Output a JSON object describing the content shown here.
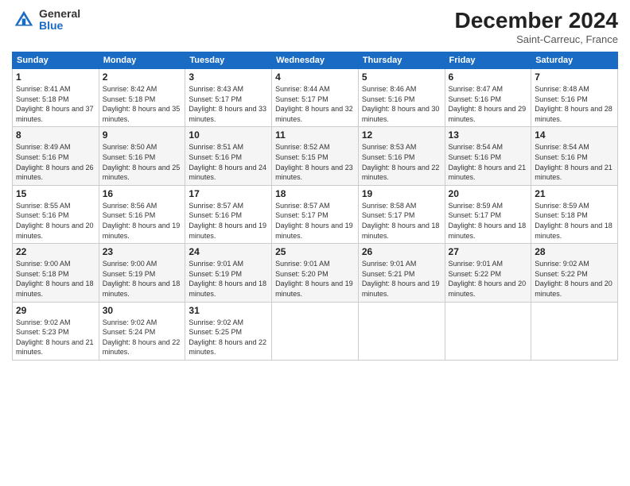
{
  "logo": {
    "general": "General",
    "blue": "Blue"
  },
  "title": "December 2024",
  "location": "Saint-Carreuc, France",
  "days_of_week": [
    "Sunday",
    "Monday",
    "Tuesday",
    "Wednesday",
    "Thursday",
    "Friday",
    "Saturday"
  ],
  "weeks": [
    [
      {
        "day": "1",
        "sunrise": "Sunrise: 8:41 AM",
        "sunset": "Sunset: 5:18 PM",
        "daylight": "Daylight: 8 hours and 37 minutes."
      },
      {
        "day": "2",
        "sunrise": "Sunrise: 8:42 AM",
        "sunset": "Sunset: 5:18 PM",
        "daylight": "Daylight: 8 hours and 35 minutes."
      },
      {
        "day": "3",
        "sunrise": "Sunrise: 8:43 AM",
        "sunset": "Sunset: 5:17 PM",
        "daylight": "Daylight: 8 hours and 33 minutes."
      },
      {
        "day": "4",
        "sunrise": "Sunrise: 8:44 AM",
        "sunset": "Sunset: 5:17 PM",
        "daylight": "Daylight: 8 hours and 32 minutes."
      },
      {
        "day": "5",
        "sunrise": "Sunrise: 8:46 AM",
        "sunset": "Sunset: 5:16 PM",
        "daylight": "Daylight: 8 hours and 30 minutes."
      },
      {
        "day": "6",
        "sunrise": "Sunrise: 8:47 AM",
        "sunset": "Sunset: 5:16 PM",
        "daylight": "Daylight: 8 hours and 29 minutes."
      },
      {
        "day": "7",
        "sunrise": "Sunrise: 8:48 AM",
        "sunset": "Sunset: 5:16 PM",
        "daylight": "Daylight: 8 hours and 28 minutes."
      }
    ],
    [
      {
        "day": "8",
        "sunrise": "Sunrise: 8:49 AM",
        "sunset": "Sunset: 5:16 PM",
        "daylight": "Daylight: 8 hours and 26 minutes."
      },
      {
        "day": "9",
        "sunrise": "Sunrise: 8:50 AM",
        "sunset": "Sunset: 5:16 PM",
        "daylight": "Daylight: 8 hours and 25 minutes."
      },
      {
        "day": "10",
        "sunrise": "Sunrise: 8:51 AM",
        "sunset": "Sunset: 5:16 PM",
        "daylight": "Daylight: 8 hours and 24 minutes."
      },
      {
        "day": "11",
        "sunrise": "Sunrise: 8:52 AM",
        "sunset": "Sunset: 5:15 PM",
        "daylight": "Daylight: 8 hours and 23 minutes."
      },
      {
        "day": "12",
        "sunrise": "Sunrise: 8:53 AM",
        "sunset": "Sunset: 5:16 PM",
        "daylight": "Daylight: 8 hours and 22 minutes."
      },
      {
        "day": "13",
        "sunrise": "Sunrise: 8:54 AM",
        "sunset": "Sunset: 5:16 PM",
        "daylight": "Daylight: 8 hours and 21 minutes."
      },
      {
        "day": "14",
        "sunrise": "Sunrise: 8:54 AM",
        "sunset": "Sunset: 5:16 PM",
        "daylight": "Daylight: 8 hours and 21 minutes."
      }
    ],
    [
      {
        "day": "15",
        "sunrise": "Sunrise: 8:55 AM",
        "sunset": "Sunset: 5:16 PM",
        "daylight": "Daylight: 8 hours and 20 minutes."
      },
      {
        "day": "16",
        "sunrise": "Sunrise: 8:56 AM",
        "sunset": "Sunset: 5:16 PM",
        "daylight": "Daylight: 8 hours and 19 minutes."
      },
      {
        "day": "17",
        "sunrise": "Sunrise: 8:57 AM",
        "sunset": "Sunset: 5:16 PM",
        "daylight": "Daylight: 8 hours and 19 minutes."
      },
      {
        "day": "18",
        "sunrise": "Sunrise: 8:57 AM",
        "sunset": "Sunset: 5:17 PM",
        "daylight": "Daylight: 8 hours and 19 minutes."
      },
      {
        "day": "19",
        "sunrise": "Sunrise: 8:58 AM",
        "sunset": "Sunset: 5:17 PM",
        "daylight": "Daylight: 8 hours and 18 minutes."
      },
      {
        "day": "20",
        "sunrise": "Sunrise: 8:59 AM",
        "sunset": "Sunset: 5:17 PM",
        "daylight": "Daylight: 8 hours and 18 minutes."
      },
      {
        "day": "21",
        "sunrise": "Sunrise: 8:59 AM",
        "sunset": "Sunset: 5:18 PM",
        "daylight": "Daylight: 8 hours and 18 minutes."
      }
    ],
    [
      {
        "day": "22",
        "sunrise": "Sunrise: 9:00 AM",
        "sunset": "Sunset: 5:18 PM",
        "daylight": "Daylight: 8 hours and 18 minutes."
      },
      {
        "day": "23",
        "sunrise": "Sunrise: 9:00 AM",
        "sunset": "Sunset: 5:19 PM",
        "daylight": "Daylight: 8 hours and 18 minutes."
      },
      {
        "day": "24",
        "sunrise": "Sunrise: 9:01 AM",
        "sunset": "Sunset: 5:19 PM",
        "daylight": "Daylight: 8 hours and 18 minutes."
      },
      {
        "day": "25",
        "sunrise": "Sunrise: 9:01 AM",
        "sunset": "Sunset: 5:20 PM",
        "daylight": "Daylight: 8 hours and 19 minutes."
      },
      {
        "day": "26",
        "sunrise": "Sunrise: 9:01 AM",
        "sunset": "Sunset: 5:21 PM",
        "daylight": "Daylight: 8 hours and 19 minutes."
      },
      {
        "day": "27",
        "sunrise": "Sunrise: 9:01 AM",
        "sunset": "Sunset: 5:22 PM",
        "daylight": "Daylight: 8 hours and 20 minutes."
      },
      {
        "day": "28",
        "sunrise": "Sunrise: 9:02 AM",
        "sunset": "Sunset: 5:22 PM",
        "daylight": "Daylight: 8 hours and 20 minutes."
      }
    ],
    [
      {
        "day": "29",
        "sunrise": "Sunrise: 9:02 AM",
        "sunset": "Sunset: 5:23 PM",
        "daylight": "Daylight: 8 hours and 21 minutes."
      },
      {
        "day": "30",
        "sunrise": "Sunrise: 9:02 AM",
        "sunset": "Sunset: 5:24 PM",
        "daylight": "Daylight: 8 hours and 22 minutes."
      },
      {
        "day": "31",
        "sunrise": "Sunrise: 9:02 AM",
        "sunset": "Sunset: 5:25 PM",
        "daylight": "Daylight: 8 hours and 22 minutes."
      },
      null,
      null,
      null,
      null
    ]
  ]
}
